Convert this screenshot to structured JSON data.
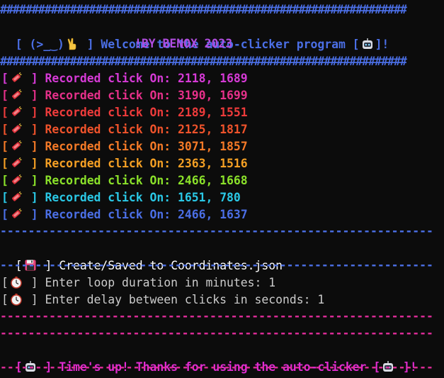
{
  "header": {
    "top_rule": "################################################################",
    "welcome_open": "[ (>_‿)",
    "welcome_close": " ] Welcome to the auto-clicker program [",
    "welcome_end": "]!",
    "byline": "!BY BENOX 2023",
    "bottom_rule": "################################################################",
    "colors": {
      "rule": "#4b6fe6",
      "welcome": "#4b6fe6",
      "byline": "#b14de0"
    }
  },
  "clicks": [
    {
      "label": "Recorded click On: ",
      "coords": "2118, 1689",
      "color": "#d63ad6"
    },
    {
      "label": "Recorded click On: ",
      "coords": "3190, 1699",
      "color": "#e6308a"
    },
    {
      "label": "Recorded click On: ",
      "coords": "2189, 1551",
      "color": "#ee3b3b"
    },
    {
      "label": "Recorded click On: ",
      "coords": "2125, 1817",
      "color": "#f0532b"
    },
    {
      "label": "Recorded click On: ",
      "coords": "3071, 1857",
      "color": "#f57a27"
    },
    {
      "label": "Recorded click On: ",
      "coords": "2363, 1516",
      "color": "#f5a024"
    },
    {
      "label": "Recorded click On: ",
      "coords": "2466, 1668",
      "color": "#8be22a"
    },
    {
      "label": "Recorded click On: ",
      "coords": "1651, 780",
      "color": "#2ac8e6"
    },
    {
      "label": "Recorded click On: ",
      "coords": "2466, 1637",
      "color": "#4b6fe6"
    }
  ],
  "click_icon": "firecracker-icon",
  "separators": {
    "blue_dash": "--------------------------------------------------------------",
    "pink_dash": "--------------------------------------------------------------",
    "blue_color": "#4b6fe6",
    "pink_color": "#e02c9a"
  },
  "save": {
    "open": "[",
    "text": " ] Create/Saved to Coordinates.json",
    "icon": "floppy-disk-icon"
  },
  "prompts": [
    {
      "open": "[",
      "text": " ] Enter loop duration in minutes: 1"
    },
    {
      "open": "[",
      "text": " ] Enter delay between clicks in seconds: 1"
    }
  ],
  "prompt_icon": "stopwatch-icon",
  "footer": {
    "open": "[",
    "text": " ] Time's up! Thanks for using the auto-clicker [",
    "end": " ]!",
    "color": "#e02cd0",
    "icon": "robot-icon"
  }
}
